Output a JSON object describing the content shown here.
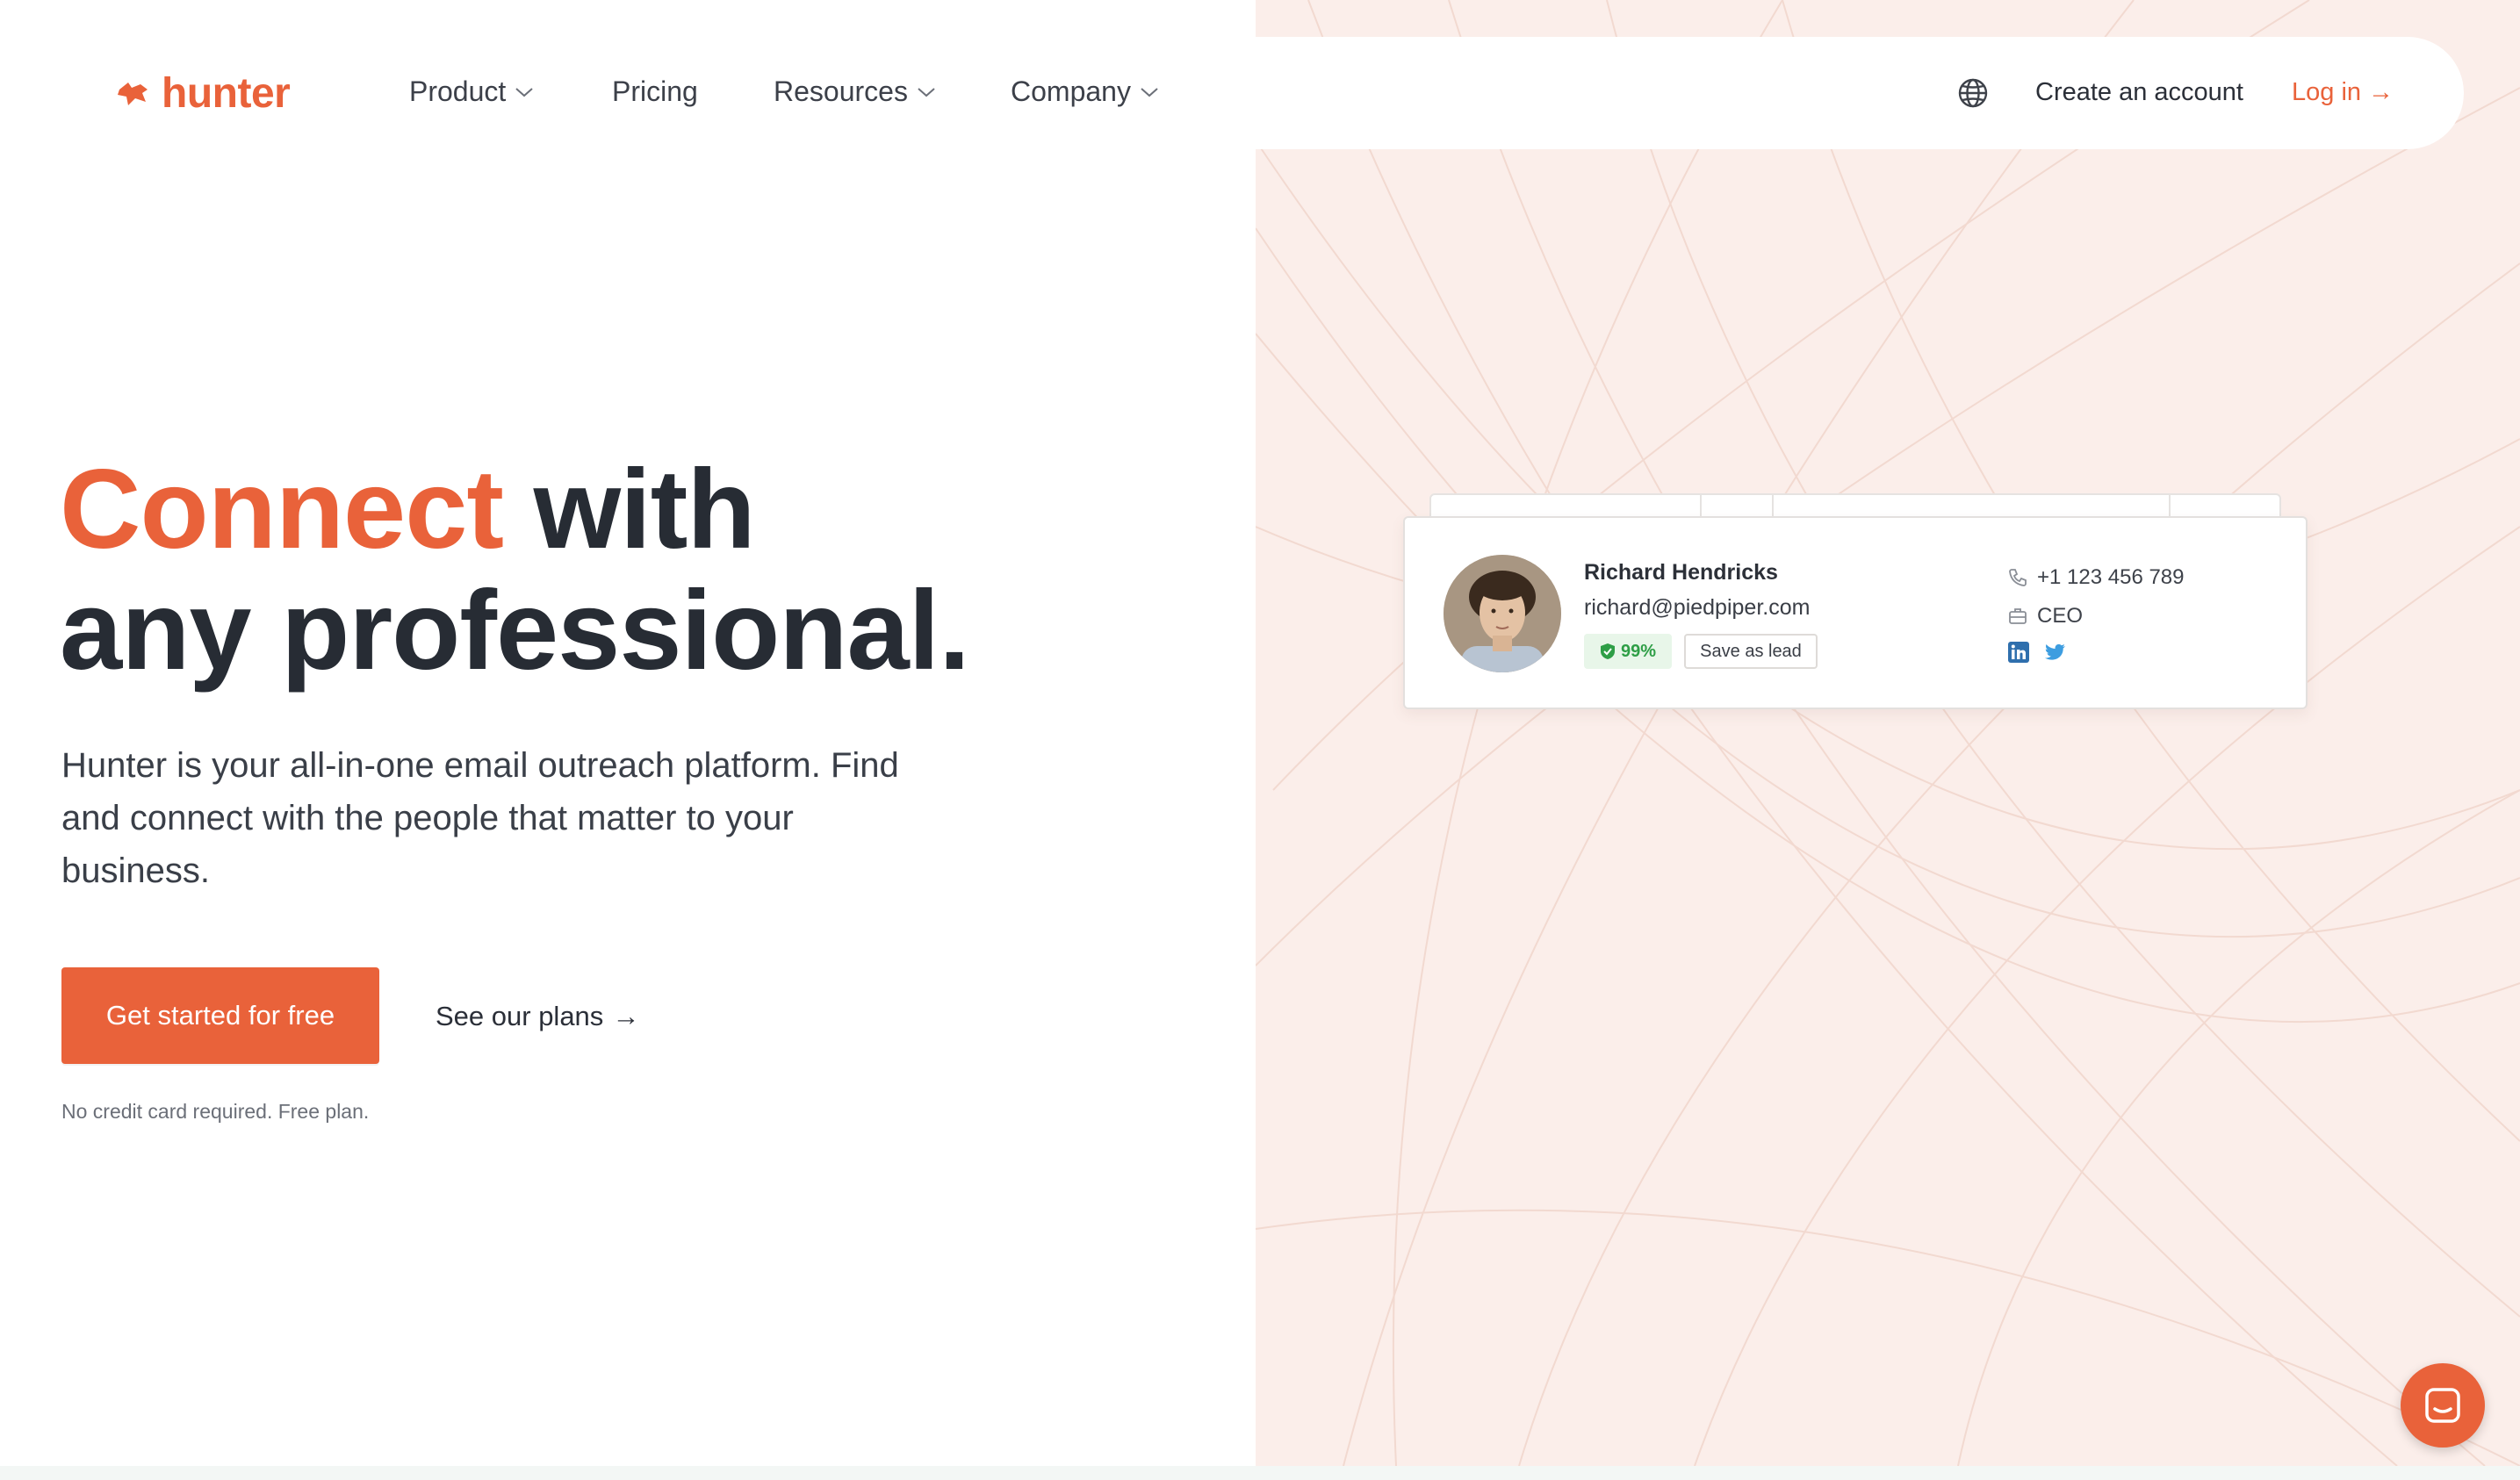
{
  "brand": {
    "name": "hunter",
    "accent_color": "#e9623a"
  },
  "nav": {
    "items": [
      {
        "label": "Product",
        "has_dropdown": true
      },
      {
        "label": "Pricing",
        "has_dropdown": false
      },
      {
        "label": "Resources",
        "has_dropdown": true
      },
      {
        "label": "Company",
        "has_dropdown": true
      }
    ],
    "language_icon": "globe-icon",
    "create_account": "Create an account",
    "login": "Log in",
    "login_arrow": "→"
  },
  "hero": {
    "title_accent": "Connect",
    "title_rest_line1": " with",
    "title_line2": "any professional.",
    "description": "Hunter is your all-in-one email outreach platform. Find and connect with the people that matter to your business.",
    "cta": "Get started for free",
    "secondary_link": "See our plans",
    "secondary_arrow": "→",
    "fine_print": "No credit card required. Free plan."
  },
  "contact_card": {
    "name": "Richard Hendricks",
    "email": "richard@piedpiper.com",
    "score": "99%",
    "save_label": "Save as lead",
    "phone": "+1 123 456 789",
    "title": "CEO",
    "socials": [
      "linkedin-icon",
      "twitter-icon"
    ]
  },
  "chat": {
    "icon": "chat-icon"
  }
}
